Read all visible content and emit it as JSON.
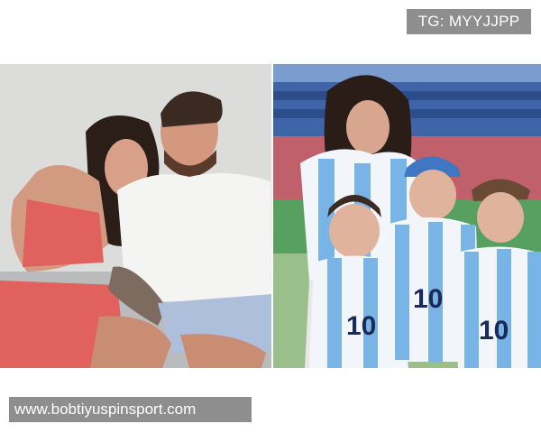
{
  "overlay": {
    "tg_label": "TG: MYYJJPP",
    "watermark_url": "www.bobtiyuspinsport.com"
  },
  "photos": {
    "left": {
      "subject": "couple-sitting-indoors",
      "colors": {
        "wall": "#dcdcda",
        "dress": "#e0615d",
        "shirt": "#f4f4f2",
        "shorts": "#aebfdc"
      }
    },
    "right": {
      "subject": "family-at-stadium",
      "colors": {
        "kit_sky": "#78b4e6",
        "kit_white": "#f2f6fb",
        "crowd": "#c0606a",
        "field": "#58a060"
      }
    }
  },
  "kit_numbers": [
    "10",
    "10",
    "10"
  ]
}
